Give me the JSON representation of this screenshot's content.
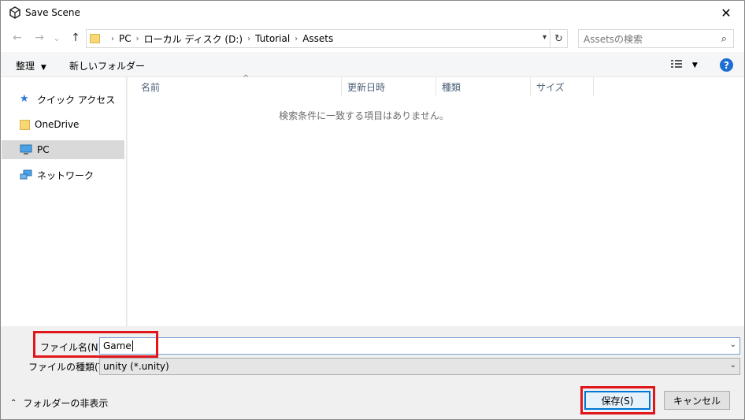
{
  "window": {
    "title": "Save Scene",
    "close_glyph": "✕"
  },
  "nav": {
    "back_glyph": "←",
    "forward_glyph": "→",
    "recent_glyph": "⌄",
    "up_glyph": "↑",
    "breadcrumbs": [
      "PC",
      "ローカル ディスク (D:)",
      "Tutorial",
      "Assets"
    ],
    "refresh_glyph": "↻",
    "search_placeholder": "Assetsの検索",
    "search_glyph": "⌕"
  },
  "toolbar": {
    "organize_label": "整理",
    "new_folder_label": "新しいフォルダー",
    "help_label": "?"
  },
  "sidebar": {
    "items": [
      {
        "label": "クイック アクセス",
        "icon": "star-icon"
      },
      {
        "label": "OneDrive",
        "icon": "folder-icon"
      },
      {
        "label": "PC",
        "icon": "pc-icon",
        "selected": true
      },
      {
        "label": "ネットワーク",
        "icon": "network-icon"
      }
    ]
  },
  "columns": [
    "名前",
    "更新日時",
    "種類",
    "サイズ"
  ],
  "empty_message": "検索条件に一致する項目はありません。",
  "form": {
    "filename_label": "ファイル名(N):",
    "filename_value": "Game",
    "filetype_label": "ファイルの種類(T):",
    "filetype_value": "unity (*.unity)"
  },
  "footer": {
    "hide_folders_label": "フォルダーの非表示",
    "save_label": "保存(S)",
    "cancel_label": "キャンセル"
  },
  "colors": {
    "accent": "#0078d7",
    "highlight_box": "#e0161b",
    "help_icon": "#1e6fd3"
  }
}
